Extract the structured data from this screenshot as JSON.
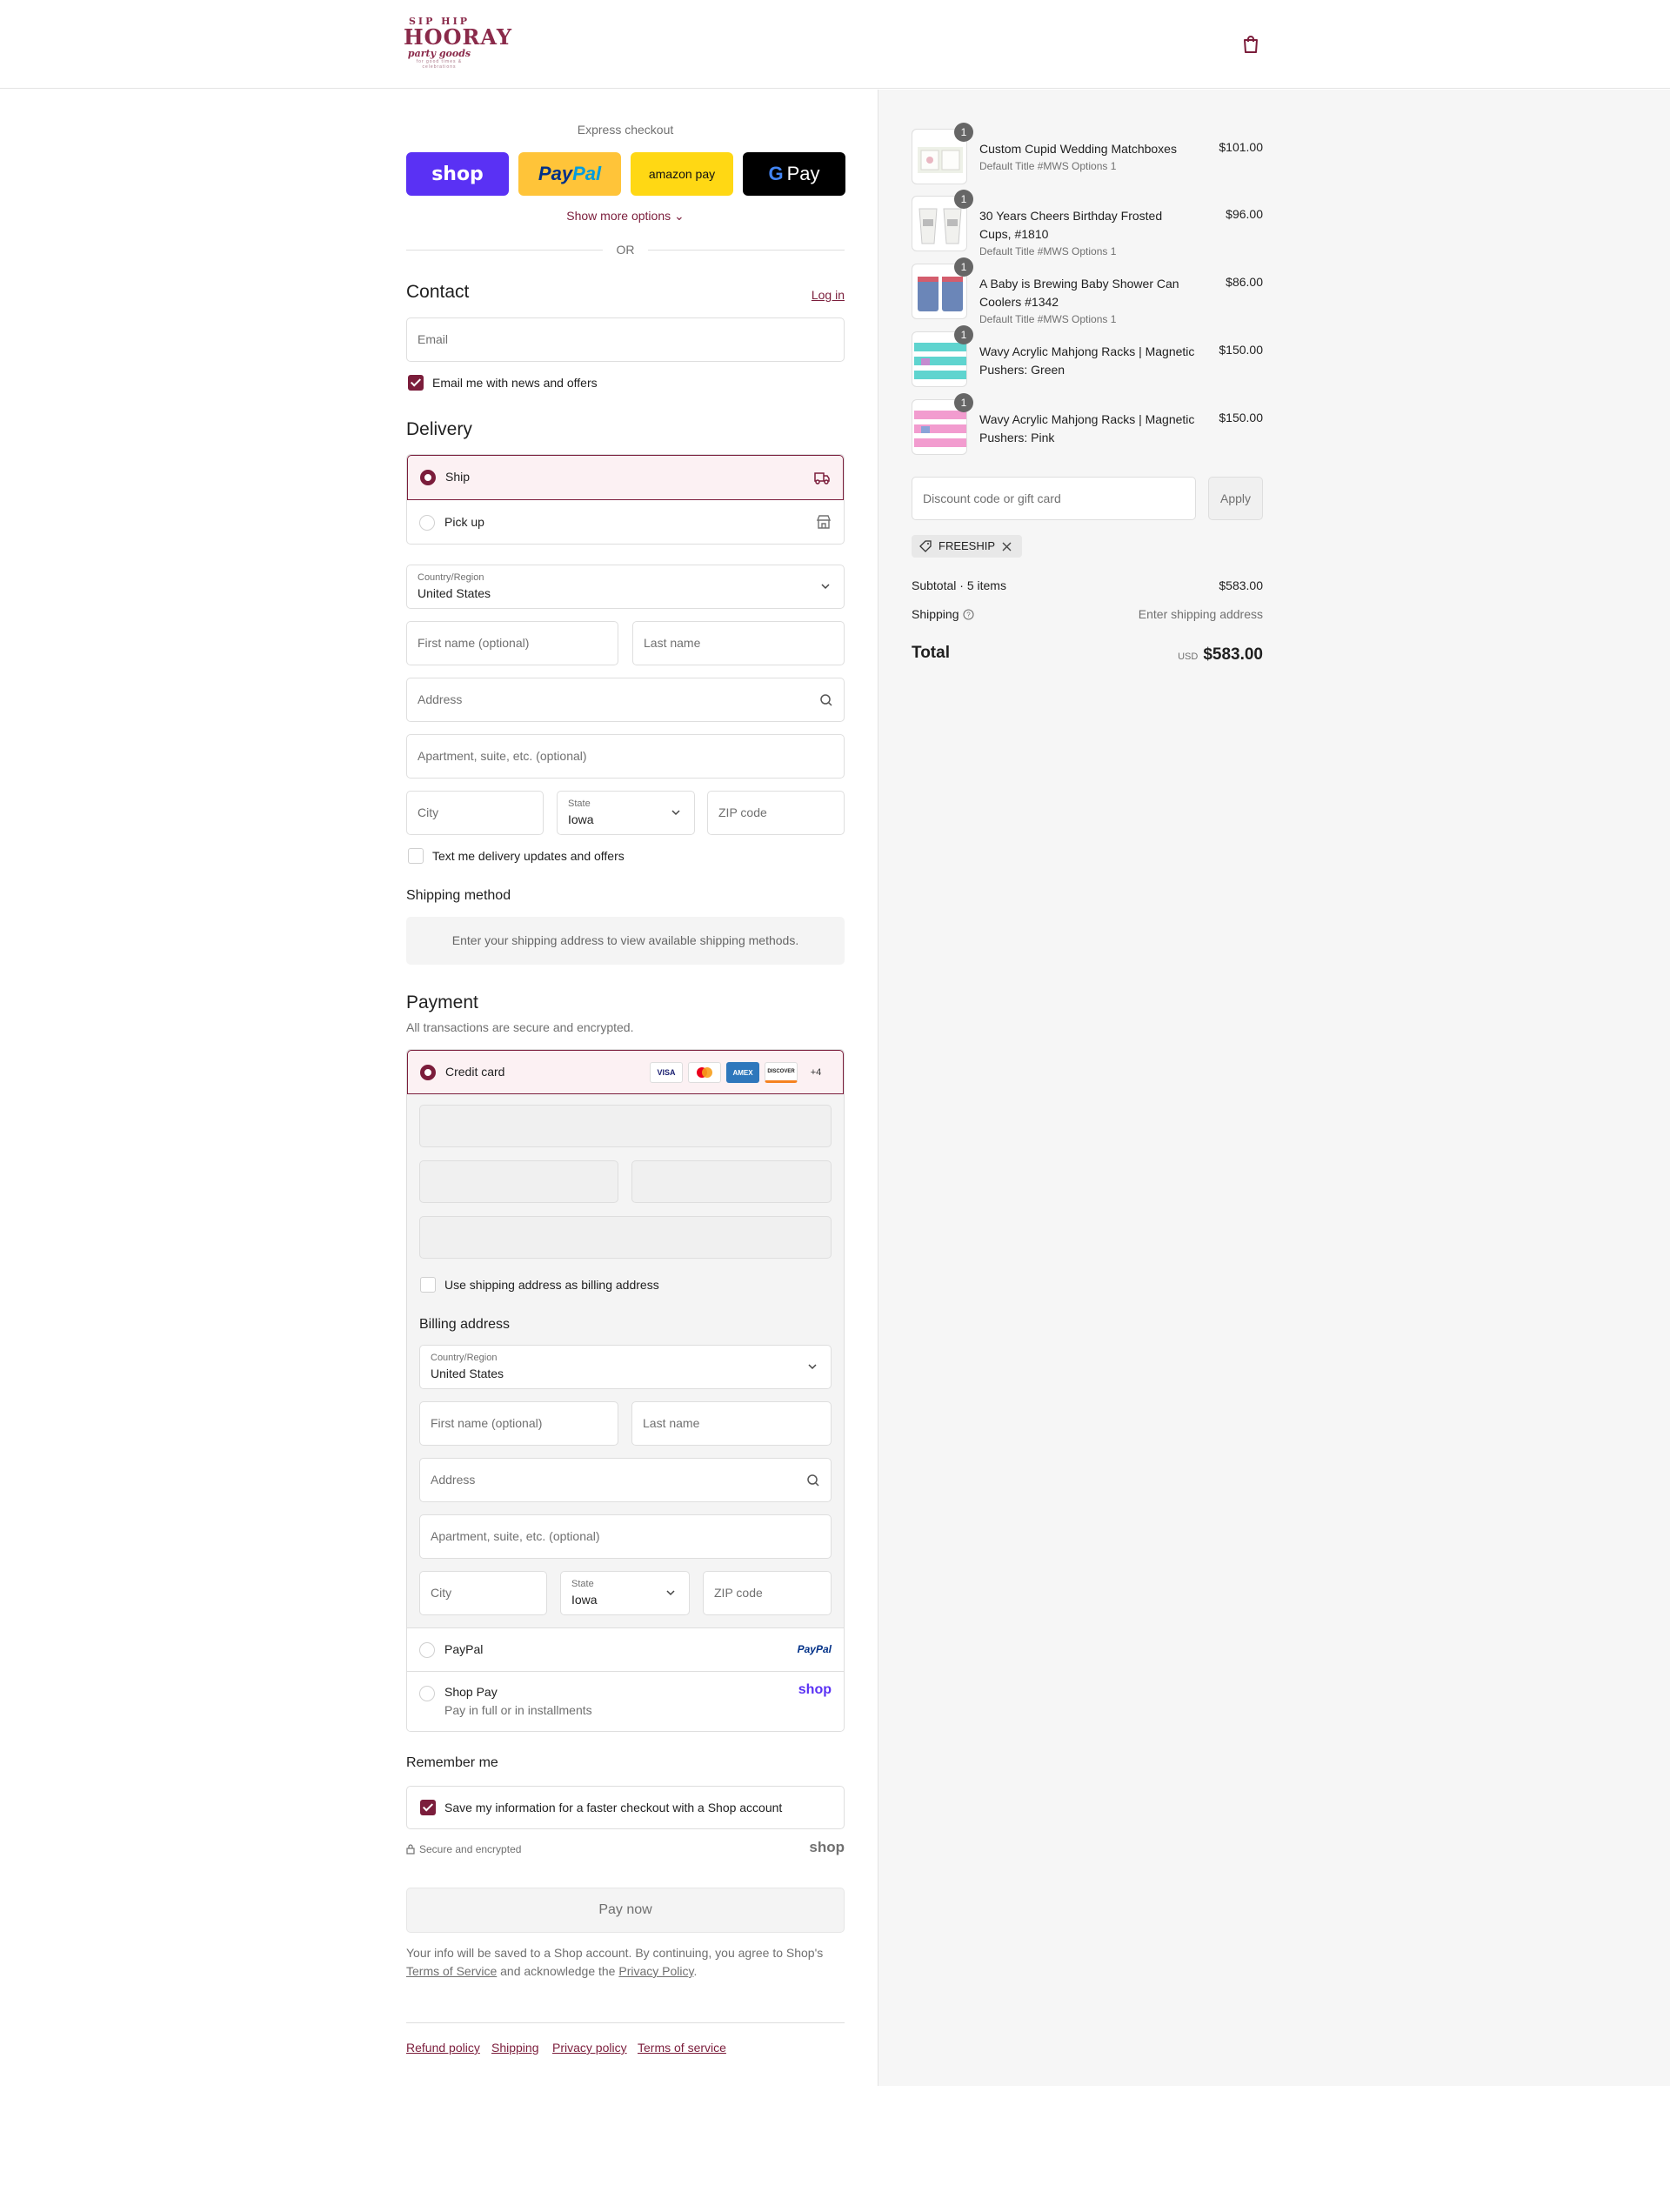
{
  "header": {
    "logo": {
      "line1": "SIP HIP",
      "line2": "HOORAY",
      "line3": "party goods",
      "line4": "for good times & celebrations"
    }
  },
  "express": {
    "title": "Express checkout",
    "buttons": {
      "shop": "shop",
      "paypal_a": "Pay",
      "paypal_b": "Pal",
      "amazon": "amazon pay",
      "gpay": "Pay"
    },
    "show_more": "Show more options",
    "or": "OR"
  },
  "contact": {
    "title": "Contact",
    "login": "Log in",
    "email_placeholder": "Email",
    "email_opt_in": "Email me with news and offers",
    "email_opt_in_checked": true
  },
  "delivery": {
    "title": "Delivery",
    "options": [
      {
        "label": "Ship",
        "selected": true,
        "icon": "truck-icon"
      },
      {
        "label": "Pick up",
        "selected": false,
        "icon": "store-icon"
      }
    ],
    "country_label": "Country/Region",
    "country_value": "United States",
    "first_name": "First name (optional)",
    "last_name": "Last name",
    "address": "Address",
    "apartment": "Apartment, suite, etc. (optional)",
    "city": "City",
    "state_label": "State",
    "state_value": "Iowa",
    "zip": "ZIP code",
    "sms_opt_in": "Text me delivery updates and offers"
  },
  "shipping_method": {
    "title": "Shipping method",
    "info": "Enter your shipping address to view available shipping methods."
  },
  "payment": {
    "title": "Payment",
    "subtitle": "All transactions are secure and encrypted.",
    "credit_card": "Credit card",
    "card_brands": [
      "VISA",
      "",
      "AMEX",
      "DISCOVER"
    ],
    "more_cards": "+4",
    "billing_same": "Use shipping address as billing address",
    "billing": {
      "title": "Billing address",
      "country_label": "Country/Region",
      "country_value": "United States",
      "first_name": "First name (optional)",
      "last_name": "Last name",
      "address": "Address",
      "apartment": "Apartment, suite, etc. (optional)",
      "city": "City",
      "state_label": "State",
      "state_value": "Iowa",
      "zip": "ZIP code"
    },
    "paypal": "PayPal",
    "paypal_logo": "PayPal",
    "shoppay": "Shop Pay",
    "shoppay_sub": "Pay in full or in installments",
    "shoppay_logo": "shop"
  },
  "remember": {
    "title": "Remember me",
    "save_info": "Save my information for a faster checkout with a Shop account",
    "secure": "Secure and encrypted",
    "shop_logo": "shop"
  },
  "pay_now": "Pay now",
  "legal": {
    "text1": "Your info will be saved to a Shop account. By continuing, you agree to Shop's",
    "tos": "Terms of Service",
    "text2": "and acknowledge the",
    "privacy": "Privacy Policy",
    "text3": "."
  },
  "footer_links": [
    "Refund policy",
    "Shipping",
    "Privacy policy",
    "Terms of service"
  ],
  "cart": {
    "items": [
      {
        "qty": "1",
        "name": "Custom Cupid Wedding Matchboxes",
        "variant": "Default Title #MWS Options 1",
        "price": "$101.00"
      },
      {
        "qty": "1",
        "name": "30 Years Cheers Birthday Frosted Cups, #1810",
        "variant": "Default Title #MWS Options 1",
        "price": "$96.00"
      },
      {
        "qty": "1",
        "name": "A Baby is Brewing Baby Shower Can Coolers #1342",
        "variant": "Default Title #MWS Options 1",
        "price": "$86.00"
      },
      {
        "qty": "1",
        "name": "Wavy Acrylic Mahjong Racks | Magnetic Pushers: Green",
        "variant": "",
        "price": "$150.00"
      },
      {
        "qty": "1",
        "name": "Wavy Acrylic Mahjong Racks | Magnetic Pushers: Pink",
        "variant": "",
        "price": "$150.00"
      }
    ],
    "discount_placeholder": "Discount code or gift card",
    "apply": "Apply",
    "code": "FREESHIP",
    "subtotal_label": "Subtotal · 5 items",
    "subtotal": "$583.00",
    "shipping_label": "Shipping",
    "shipping_value": "Enter shipping address",
    "total_label": "Total",
    "currency": "USD",
    "total": "$583.00"
  },
  "colors": {
    "accent": "#7b1d3b",
    "shop": "#5a31f4",
    "paypal": "#ffc439",
    "amazon": "#ffd814"
  }
}
